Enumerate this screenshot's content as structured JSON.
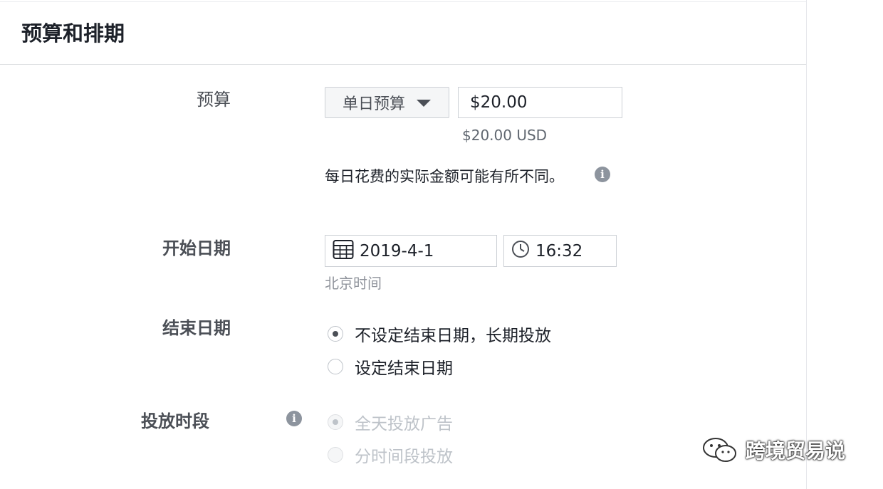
{
  "header": {
    "title": "预算和排期"
  },
  "budget": {
    "label": "预算",
    "type_selected": "单日预算",
    "amount_value": "$20.00",
    "amount_usd": "$20.00 USD",
    "note": "每日花费的实际金额可能有所不同。"
  },
  "start": {
    "label": "开始日期",
    "date": "2019-4-1",
    "time": "16:32",
    "timezone": "北京时间"
  },
  "end": {
    "label": "结束日期",
    "options": [
      {
        "label": "不设定结束日期，长期投放",
        "selected": true
      },
      {
        "label": "设定结束日期",
        "selected": false
      }
    ]
  },
  "schedule": {
    "label": "投放时段",
    "options": [
      {
        "label": "全天投放广告",
        "selected": true,
        "disabled": true
      },
      {
        "label": "分时间段投放",
        "selected": false,
        "disabled": true
      }
    ]
  },
  "watermark": {
    "text": "跨境贸易说"
  },
  "icons": {
    "info": "info-icon",
    "calendar": "calendar-icon",
    "clock": "clock-icon",
    "caret": "caret-down-icon",
    "wechat": "wechat-logo"
  },
  "colors": {
    "text": "#1d2129",
    "muted": "#90949c",
    "border": "#ccd0d5",
    "disabled": "#bec3c9"
  }
}
